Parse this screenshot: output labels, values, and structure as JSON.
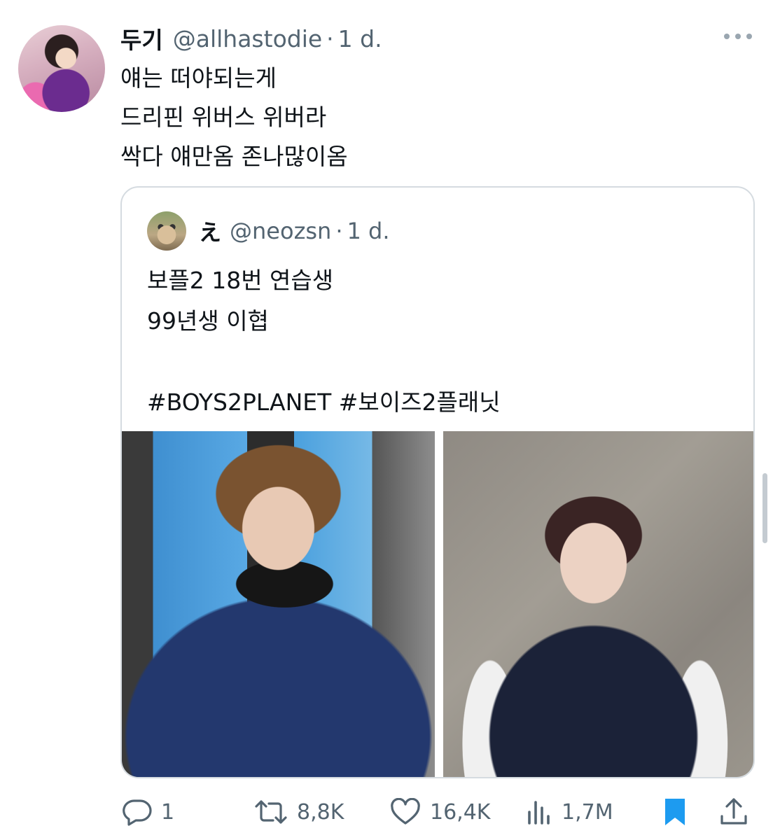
{
  "tweet": {
    "display_name": "두기",
    "handle": "@allhastodie",
    "separator": "·",
    "time": "1 d.",
    "lines": [
      "얘는 떠야되는게",
      "드리핀 위버스 위버라",
      "싹다 얘만옴 존나많이옴"
    ]
  },
  "quote": {
    "display_name": "え",
    "handle": "@neozsn",
    "separator": "·",
    "time": "1 d.",
    "lines": [
      "보플2 18번 연습생",
      "99년생 이협",
      "",
      "#BOYS2PLANET #보이즈2플래닛"
    ]
  },
  "actions": {
    "replies": "1",
    "retweets": "8,8K",
    "likes": "16,4K",
    "views": "1,7M"
  },
  "colors": {
    "text": "#0f1419",
    "secondary": "#536471",
    "bookmark": "#1d9bf0",
    "border": "#d5dbe0"
  }
}
